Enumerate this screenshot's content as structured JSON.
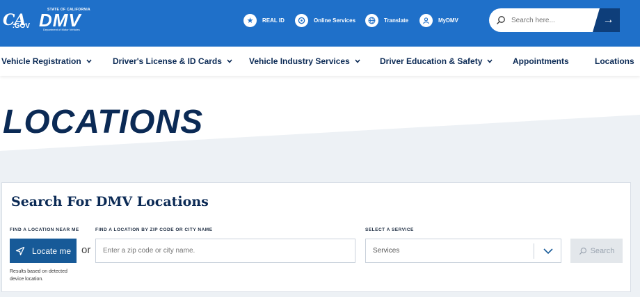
{
  "header": {
    "ca_logo_text": "CA",
    "ca_logo_sub": ".GOV",
    "dmv_state": "STATE OF CALIFORNIA",
    "dmv_logo": "DMV",
    "dmv_dept": "Department of Motor Vehicles",
    "utility": [
      {
        "label": "REAL ID",
        "icon": "star-icon"
      },
      {
        "label": "Online Services",
        "icon": "online-services-icon"
      },
      {
        "label": "Translate",
        "icon": "globe-icon"
      },
      {
        "label": "MyDMV",
        "icon": "user-icon"
      }
    ],
    "search_placeholder": "Search here..."
  },
  "nav": {
    "items": [
      {
        "label": "Vehicle Registration"
      },
      {
        "label": "Driver's License & ID Cards"
      },
      {
        "label": "Vehicle Industry Services"
      },
      {
        "label": "Driver Education & Safety"
      },
      {
        "label": "Appointments"
      },
      {
        "label": "Locations"
      }
    ]
  },
  "page": {
    "title": "LOCATIONS"
  },
  "search_card": {
    "title": "Search For DMV Locations",
    "near_label": "FIND A LOCATION NEAR ME",
    "zip_label": "FIND A LOCATION BY ZIP CODE OR CITY NAME",
    "service_label": "SELECT A SERVICE",
    "locate_button": "Locate me",
    "or_text": "or",
    "zip_placeholder": "Enter a zip code or city name.",
    "service_value": "Services",
    "search_button": "Search",
    "note": "Results based on detected device location."
  },
  "colors": {
    "topbar": "#1f70c9",
    "navy": "#0b2a55",
    "button": "#175a98"
  }
}
